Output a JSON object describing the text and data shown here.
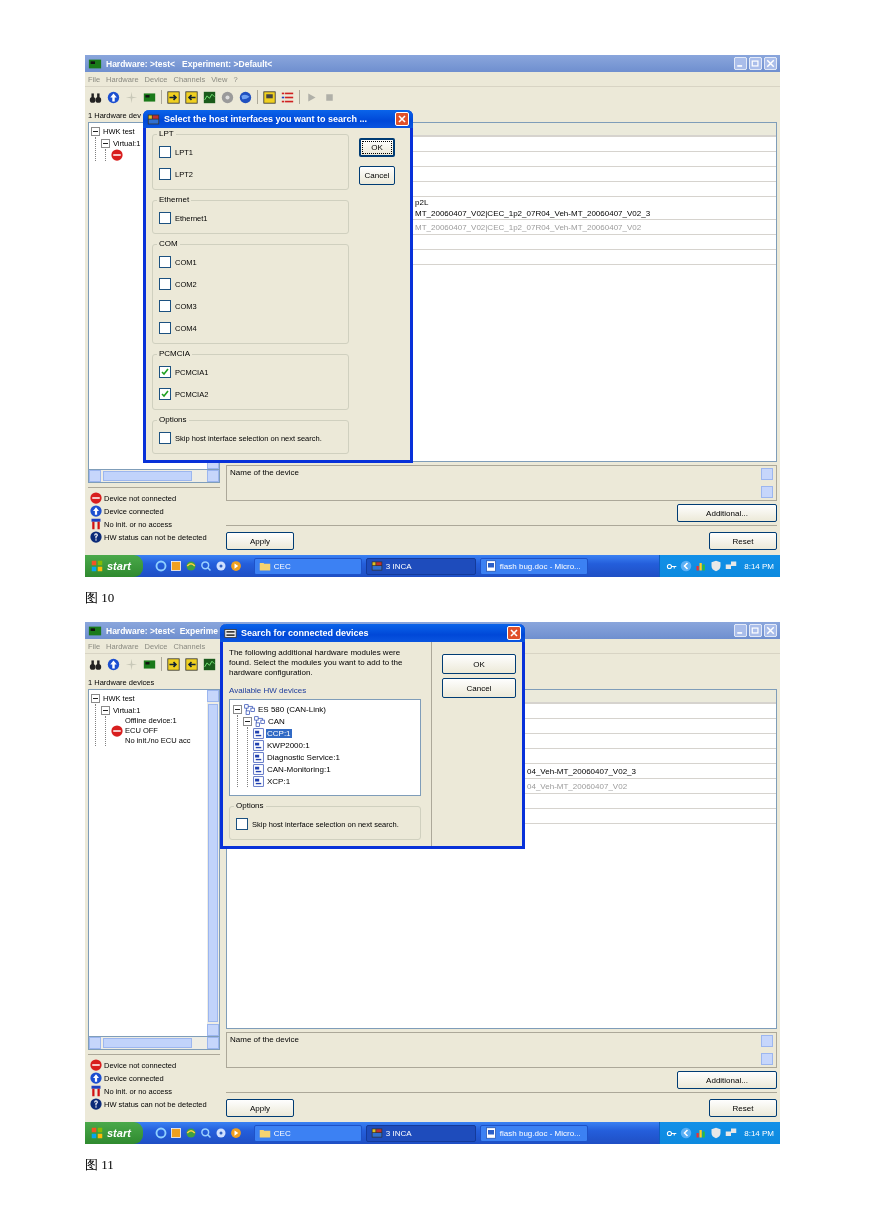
{
  "figures": [
    {
      "window": {
        "title": "Hardware: >test<   Experiment: >Default<"
      },
      "menu": [
        "File",
        "Hardware",
        "Device",
        "Channels",
        "View",
        "?"
      ],
      "panel_label": "1 Hardware dev",
      "tree": [
        {
          "label": "HWK test",
          "expanded": true,
          "children": [
            {
              "label": "Virtual:1",
              "expanded": true,
              "children": [
                {
                  "kind": "stop"
                }
              ]
            }
          ]
        }
      ],
      "legend": [
        {
          "kind": "stop",
          "label": "Device not connected"
        },
        {
          "kind": "connected",
          "label": "Device connected"
        },
        {
          "kind": "noinit",
          "label": "No init. or no access"
        },
        {
          "kind": "unknown",
          "label": "HW status can not be detected"
        }
      ],
      "table_rows": [
        {
          "kind": "empty"
        },
        {
          "kind": "empty"
        },
        {
          "kind": "empty"
        },
        {
          "kind": "empty"
        },
        {
          "kind": "text",
          "lines": [
            "p2L",
            "MT_20060407_V02|CEC_1p2_07R04_Veh-MT_20060407_V02_3"
          ],
          "disabled": false
        },
        {
          "kind": "text",
          "lines": [
            "MT_20060407_V02|CEC_1p2_07R04_Veh-MT_20060407_V02"
          ],
          "disabled": true
        },
        {
          "kind": "empty"
        },
        {
          "kind": "empty"
        }
      ],
      "description": "Name of the device",
      "additional_button": "Additional...",
      "apply_button": "Apply",
      "reset_button": "Reset",
      "taskbar": {
        "start": "start",
        "tasks": [
          {
            "label": "CEC",
            "kind": "folder",
            "selected": false
          },
          {
            "label": "3 INCA",
            "kind": "app",
            "selected": true
          },
          {
            "label": "flash bug.doc - Micro...",
            "kind": "document",
            "selected": false
          }
        ],
        "clock": "8:14 PM"
      },
      "dialog": {
        "kind": "interfaces",
        "title": "Select the host interfaces you want to search ...",
        "groups": [
          {
            "title": "LPT",
            "options": [
              {
                "label": "LPT1",
                "checked": false
              },
              {
                "label": "LPT2",
                "checked": false
              }
            ]
          },
          {
            "title": "Ethernet",
            "options": [
              {
                "label": "Ethernet1",
                "checked": false
              }
            ]
          },
          {
            "title": "COM",
            "options": [
              {
                "label": "COM1",
                "checked": false
              },
              {
                "label": "COM2",
                "checked": false
              },
              {
                "label": "COM3",
                "checked": false
              },
              {
                "label": "COM4",
                "checked": false
              }
            ]
          },
          {
            "title": "PCMCIA",
            "options": [
              {
                "label": "PCMCIA1",
                "checked": true
              },
              {
                "label": "PCMCIA2",
                "checked": true
              }
            ]
          }
        ],
        "options": {
          "title": "Options",
          "label": "Skip host interface selection on next search.",
          "checked": false
        },
        "buttons": [
          "OK",
          "Cancel"
        ]
      },
      "caption": "图 10"
    },
    {
      "window": {
        "title": "Hardware: >test<  Experime"
      },
      "menu": [
        "File",
        "Hardware",
        "Device",
        "Channels"
      ],
      "panel_label": "1 Hardware devices",
      "tree": [
        {
          "label": "HWK test",
          "expanded": true,
          "children": [
            {
              "label": "Virtual:1",
              "expanded": true,
              "children": [
                {
                  "kind": "stop",
                  "lines": [
                    "Offline device:1",
                    "ECU OFF",
                    "No init./no ECU acc"
                  ]
                }
              ]
            }
          ]
        }
      ],
      "legend": [
        {
          "kind": "stop",
          "label": "Device not connected"
        },
        {
          "kind": "connected",
          "label": "Device connected"
        },
        {
          "kind": "noinit",
          "label": "No init. or no access"
        },
        {
          "kind": "unknown",
          "label": "HW status can not be detected"
        }
      ],
      "table_rows": [
        {
          "kind": "empty"
        },
        {
          "kind": "empty"
        },
        {
          "kind": "empty"
        },
        {
          "kind": "empty"
        },
        {
          "kind": "text",
          "lines": [
            "04_Veh-MT_20060407_V02_3"
          ],
          "disabled": false
        },
        {
          "kind": "text",
          "lines": [
            "04_Veh-MT_20060407_V02"
          ],
          "disabled": true
        },
        {
          "kind": "empty"
        },
        {
          "kind": "empty"
        }
      ],
      "description": "Name of the device",
      "additional_button": "Additional...",
      "apply_button": "Apply",
      "reset_button": "Reset",
      "taskbar": {
        "start": "start",
        "tasks": [
          {
            "label": "CEC",
            "kind": "folder",
            "selected": false
          },
          {
            "label": "3 INCA",
            "kind": "app",
            "selected": true
          },
          {
            "label": "flash bug.doc - Micro...",
            "kind": "document",
            "selected": false
          }
        ],
        "clock": "8:14 PM"
      },
      "dialog": {
        "kind": "devices",
        "title": "Search for connected devices",
        "message": "The following additional hardware modules were found. Select the modules you want to add to the hardware configuration.",
        "list_label": "Available HW devices",
        "tree": [
          {
            "label": "ES 580 (CAN-Link)",
            "kind": "network",
            "expanded": true,
            "selected": false,
            "children": [
              {
                "label": "CAN",
                "kind": "network",
                "expanded": true,
                "selected": false,
                "children": [
                  {
                    "label": "CCP:1",
                    "kind": "module",
                    "selected": true
                  },
                  {
                    "label": "KWP2000:1",
                    "kind": "module",
                    "selected": false
                  },
                  {
                    "label": "Diagnostic Service:1",
                    "kind": "module",
                    "selected": false
                  },
                  {
                    "label": "CAN-Monitoring:1",
                    "kind": "module",
                    "selected": false
                  },
                  {
                    "label": "XCP:1",
                    "kind": "module",
                    "selected": false
                  }
                ]
              }
            ]
          }
        ],
        "options": {
          "title": "Options",
          "label": "Skip host interface selection on next search.",
          "checked": false
        },
        "buttons": [
          "OK",
          "Cancel"
        ]
      },
      "caption": "图 11"
    }
  ]
}
